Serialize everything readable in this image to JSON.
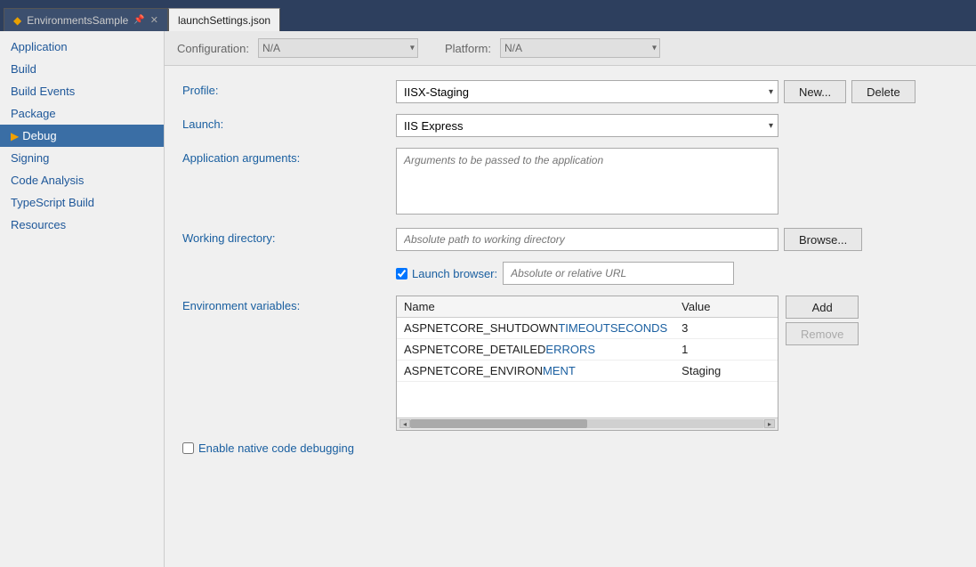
{
  "tabs": [
    {
      "label": "EnvironmentsSample",
      "icon": "◆",
      "closable": true,
      "active": false
    },
    {
      "label": "launchSettings.json",
      "active": true,
      "closable": false
    }
  ],
  "config_bar": {
    "configuration_label": "Configuration:",
    "configuration_value": "N/A",
    "platform_label": "Platform:",
    "platform_value": "N/A"
  },
  "sidebar": {
    "items": [
      {
        "label": "Application",
        "active": false
      },
      {
        "label": "Build",
        "active": false
      },
      {
        "label": "Build Events",
        "active": false
      },
      {
        "label": "Package",
        "active": false
      },
      {
        "label": "Debug",
        "active": true
      },
      {
        "label": "Signing",
        "active": false
      },
      {
        "label": "Code Analysis",
        "active": false
      },
      {
        "label": "TypeScript Build",
        "active": false
      },
      {
        "label": "Resources",
        "active": false
      }
    ]
  },
  "form": {
    "profile_label": "Profile:",
    "profile_value": "IISX-Staging",
    "profile_options": [
      "IISX-Staging"
    ],
    "new_button": "New...",
    "delete_button": "Delete",
    "launch_label": "Launch:",
    "launch_value": "IIS Express",
    "launch_options": [
      "IIS Express"
    ],
    "app_args_label": "Application arguments:",
    "app_args_placeholder": "Arguments to be passed to the application",
    "working_dir_label": "Working directory:",
    "working_dir_placeholder": "Absolute path to working directory",
    "browse_button": "Browse...",
    "launch_browser_label": "Launch browser:",
    "launch_browser_checked": true,
    "launch_browser_url_placeholder": "Absolute or relative URL",
    "env_vars_label": "Environment variables:",
    "env_table_headers": [
      "Name",
      "Value"
    ],
    "env_vars": [
      {
        "name": "ASPNETCORE_SHUTDOWNTIMEOUTSECONDS",
        "name_prefix": "ASPNETCORE_SHUTDOWN",
        "name_suffix": "TIMEOUTSECONDS",
        "value": "3"
      },
      {
        "name": "ASPNETCORE_DETAILEDERRORS",
        "name_prefix": "ASPNETCORE_DETAILED",
        "name_suffix": "ERRORS",
        "value": "1"
      },
      {
        "name": "ASPNETCORE_ENVIRONMENT",
        "name_prefix": "ASPNETCORE_ENVIRON",
        "name_suffix": "MENT",
        "value": "Staging"
      }
    ],
    "add_button": "Add",
    "remove_button": "Remove",
    "enable_native_label": "Enable native code debugging",
    "enable_native_checked": false
  }
}
